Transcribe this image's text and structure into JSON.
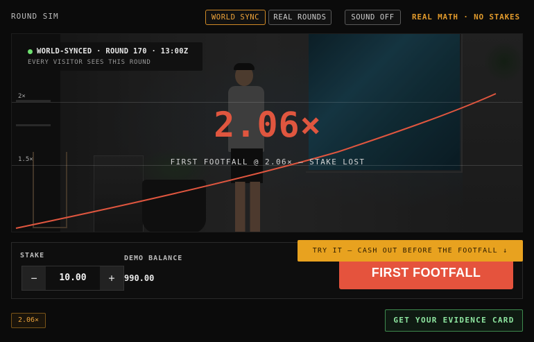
{
  "header": {
    "brand": "ROUND SIM",
    "buttons": {
      "world_sync": "WORLD SYNC",
      "real_rounds": "REAL ROUNDS",
      "sound": "SOUND OFF"
    },
    "tagline": "REAL MATH · NO STAKES"
  },
  "stage": {
    "status_line": "WORLD-SYNCED · ROUND 170 · 13:00Z",
    "status_sub": "EVERY VISITOR SEES THIS ROUND",
    "multiplier": "2.06×",
    "crash_message": "FIRST FOOTFALL @ 2.06× — STAKE LOST",
    "grid_labels": [
      "2×",
      "1.5×"
    ]
  },
  "controls": {
    "stake_label": "STAKE",
    "stake_value": "10.00",
    "decrement": "−",
    "increment": "+",
    "balance_label": "DEMO BALANCE",
    "balance_value": "990.00",
    "hint": "TRY IT — CASH OUT BEFORE THE FOOTFALL ↓",
    "action_button": "FIRST FOOTFALL"
  },
  "footer": {
    "history": [
      "2.06×"
    ],
    "evidence_button": "GET YOUR EVIDENCE CARD"
  },
  "colors": {
    "accent": "#e19a2c",
    "danger": "#e0563f",
    "success": "#8ee6a0",
    "status_dot": "#6ee070"
  }
}
